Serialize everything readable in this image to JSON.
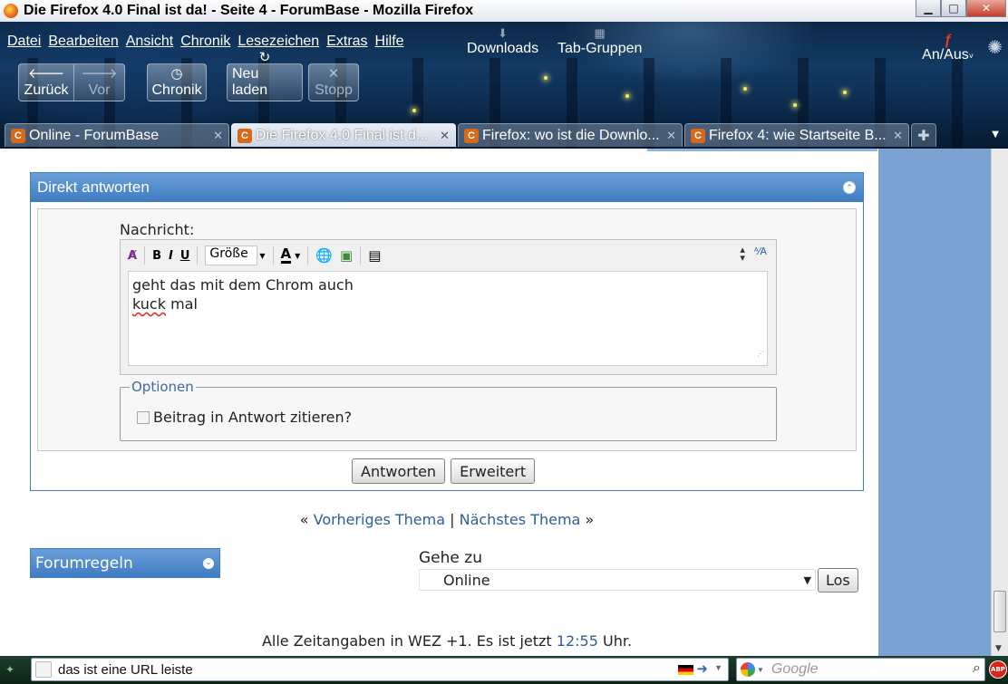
{
  "window": {
    "title": "Die Firefox 4.0 Final ist da! - Seite 4 - ForumBase - Mozilla Firefox",
    "minimize": "▁",
    "maximize": "□",
    "close": "✕"
  },
  "menubar": {
    "items": [
      "Datei",
      "Bearbeiten",
      "Ansicht",
      "Chronik",
      "Lesezeichen",
      "Extras",
      "Hilfe"
    ],
    "downloads": "Downloads",
    "tab_groups": "Tab-Gruppen"
  },
  "toolbar": {
    "back": "Zurück",
    "forward": "Vor",
    "history": "Chronik",
    "reload": "Neu laden",
    "stop": "Stopp",
    "flash_toggle": "An/Aus"
  },
  "tabs": [
    {
      "favicon": "C",
      "title": "Online - ForumBase",
      "active": false
    },
    {
      "favicon": "C",
      "title": "Die Firefox 4.0 Final ist d...",
      "active": true
    },
    {
      "favicon": "C",
      "title": "Firefox: wo ist die Downlo...",
      "active": false
    },
    {
      "favicon": "C",
      "title": "Firefox 4: wie Startseite B...",
      "active": false
    }
  ],
  "reply_panel": {
    "title": "Direkt antworten",
    "message_label": "Nachricht:",
    "size_dropdown": "Größe",
    "message_line1": "geht das mit dem Chrom auch",
    "message_line2_word": "kuck",
    "message_line2_rest": " mal",
    "options_legend": "Optionen",
    "quote_checkbox_label": "Beitrag in Antwort zitieren?",
    "quote_checked": false,
    "submit_button": "Antworten",
    "advanced_button": "Erweitert"
  },
  "topic_nav": {
    "open": "«",
    "prev": "Vorheriges Thema",
    "sep": "|",
    "next": "Nächstes Thema",
    "close": "»"
  },
  "forum_rules": {
    "title": "Forumregeln"
  },
  "goto": {
    "label": "Gehe zu",
    "selected": "Online",
    "button": "Los"
  },
  "footer": {
    "text": "Alle Zeitangaben in WEZ +1. Es ist jetzt",
    "time": "12:55",
    "suffix": "Uhr."
  },
  "urlbar": {
    "value": "das ist eine URL leiste"
  },
  "searchbar": {
    "placeholder": "Google"
  },
  "colors": {
    "panel_header": "#3e7cc1",
    "link": "#2f5d9a",
    "sidebar": "#7aa3d3"
  }
}
